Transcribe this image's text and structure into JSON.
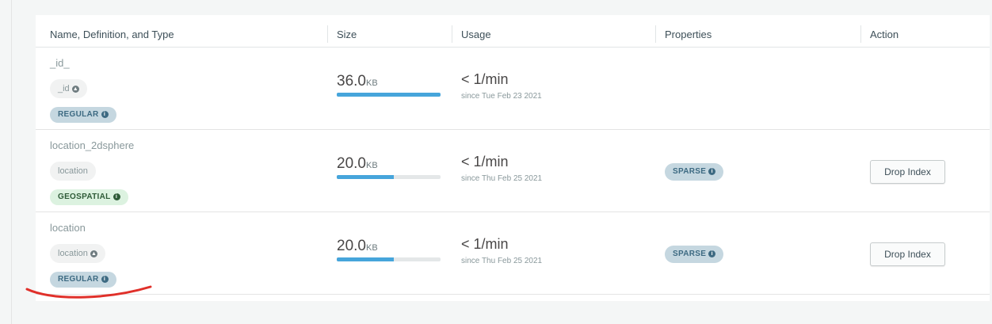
{
  "table": {
    "headers": {
      "name": "Name, Definition, and Type",
      "size": "Size",
      "usage": "Usage",
      "properties": "Properties",
      "action": "Action"
    },
    "rows": [
      {
        "name": "_id_",
        "field": "_id",
        "field_icon": "sort-ascending-icon",
        "type": "REGULAR",
        "size_value": "36.0",
        "size_unit": "KB",
        "size_fraction": 1.0,
        "usage": "< 1/min",
        "since": "since Tue Feb 23 2021",
        "property": "",
        "action": ""
      },
      {
        "name": "location_2dsphere",
        "field": "location",
        "field_icon": "",
        "type": "GEOSPATIAL",
        "size_value": "20.0",
        "size_unit": "KB",
        "size_fraction": 0.55,
        "usage": "< 1/min",
        "since": "since Thu Feb 25 2021",
        "property": "SPARSE",
        "action": "Drop Index"
      },
      {
        "name": "location",
        "field": "location",
        "field_icon": "sort-ascending-icon",
        "type": "REGULAR",
        "size_value": "20.0",
        "size_unit": "KB",
        "size_fraction": 0.55,
        "usage": "< 1/min",
        "since": "since Thu Feb 25 2021",
        "property": "SPARSE",
        "action": "Drop Index"
      }
    ]
  },
  "colors": {
    "bar_fill": "#46a5db",
    "regular_badge": "#c5d7e0",
    "geo_badge": "#dcf2e0",
    "annotation": "#e0302a"
  }
}
